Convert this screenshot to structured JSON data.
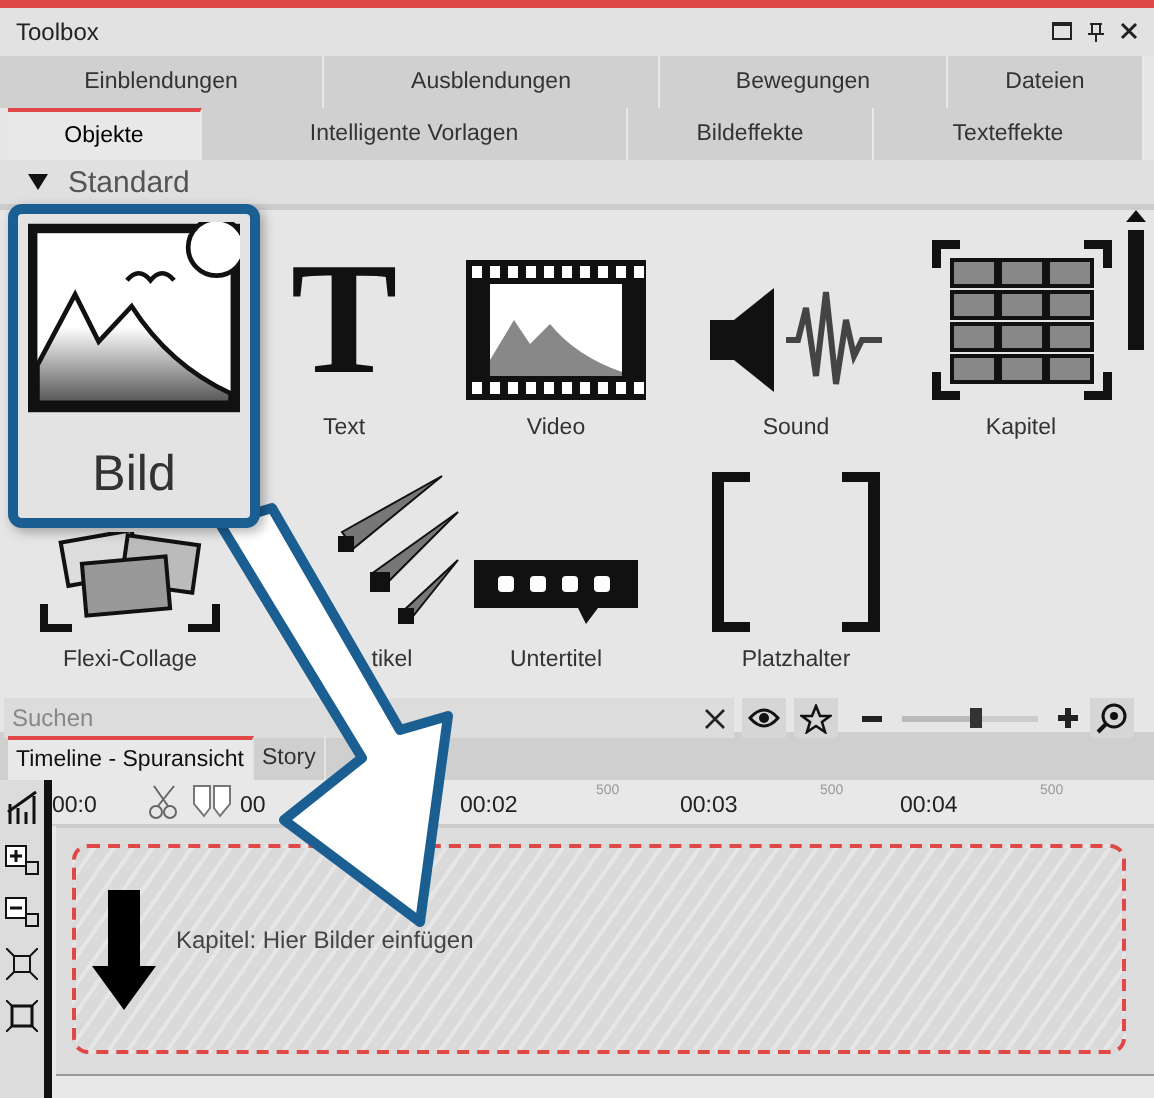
{
  "window": {
    "title": "Toolbox"
  },
  "tabs_row_1": [
    {
      "label": "Einblendungen",
      "selected": false
    },
    {
      "label": "Ausblendungen",
      "selected": false
    },
    {
      "label": "Bewegungen",
      "selected": false
    },
    {
      "label": "Dateien",
      "selected": false
    }
  ],
  "tabs_row_2": [
    {
      "label": "Objekte",
      "selected": true
    },
    {
      "label": "Intelligente Vorlagen",
      "selected": false
    },
    {
      "label": "Bildeffekte",
      "selected": false
    },
    {
      "label": "Texteffekte",
      "selected": false
    }
  ],
  "group": {
    "label": "Standard",
    "expanded": true
  },
  "items": [
    {
      "label": "Bild",
      "kind": "image",
      "highlighted": true
    },
    {
      "label": "Text",
      "kind": "text",
      "glyph": "T",
      "highlighted": false
    },
    {
      "label": "Video",
      "kind": "video",
      "highlighted": false
    },
    {
      "label": "Sound",
      "kind": "sound",
      "highlighted": false
    },
    {
      "label": "Kapitel",
      "kind": "chapter",
      "highlighted": false
    },
    {
      "label": "Flexi-Collage",
      "kind": "collage",
      "highlighted": false
    },
    {
      "label": "tikel",
      "kind": "particles",
      "highlighted": false
    },
    {
      "label": "Untertitel",
      "kind": "subtitle",
      "highlighted": false
    },
    {
      "label": "Platzhalter",
      "kind": "placeholder",
      "highlighted": false
    }
  ],
  "search": {
    "placeholder": "Suchen"
  },
  "zoom": {
    "level": 0.55
  },
  "timeline_tabs": [
    {
      "label": "Timeline - Spuransicht",
      "selected": true
    },
    {
      "label": "Story",
      "selected": false
    }
  ],
  "ruler": [
    {
      "label": "00:0",
      "kind": "second"
    },
    {
      "label": "00",
      "kind": "second"
    },
    {
      "label": "00:02",
      "kind": "second"
    },
    {
      "label": "500",
      "kind": "half"
    },
    {
      "label": "00:03",
      "kind": "second"
    },
    {
      "label": "500",
      "kind": "half"
    },
    {
      "label": "00:04",
      "kind": "second"
    },
    {
      "label": "500",
      "kind": "half"
    }
  ],
  "chapter": {
    "label": "Kapitel: Hier Bilder einfügen"
  }
}
